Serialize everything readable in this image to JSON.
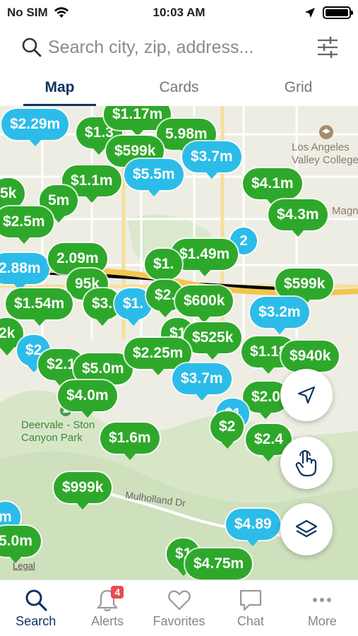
{
  "status_bar": {
    "carrier": "No SIM",
    "time": "10:03 AM"
  },
  "search": {
    "placeholder": "Search city, zip, address..."
  },
  "tabs": [
    {
      "label": "Map",
      "active": true
    },
    {
      "label": "Cards",
      "active": false
    },
    {
      "label": "Grid",
      "active": false
    }
  ],
  "map": {
    "labels": {
      "college": "Los Angeles\nValley College",
      "magn": "Magn",
      "park": "Deervale - Ston\nCanyon Park",
      "road": "Mulholland Dr",
      "legal": "Legal"
    },
    "pins": [
      {
        "price": "$2.29m",
        "color": "blue"
      },
      {
        "price": "$1.3",
        "color": "green"
      },
      {
        "price": "$1.17m",
        "color": "green"
      },
      {
        "price": "5.98m",
        "color": "green"
      },
      {
        "price": "$599k",
        "color": "green"
      },
      {
        "price": "$3.7m",
        "color": "blue"
      },
      {
        "price": "$5.5m",
        "color": "blue"
      },
      {
        "price": "$1.1m",
        "color": "green"
      },
      {
        "price": "5k",
        "color": "green"
      },
      {
        "price": "5m",
        "color": "green"
      },
      {
        "price": "$2.5m",
        "color": "green"
      },
      {
        "price": "$4.1m",
        "color": "green"
      },
      {
        "price": "$4.3m",
        "color": "green"
      },
      {
        "price": "$1.49m",
        "color": "green"
      },
      {
        "price": "2.88m",
        "color": "blue"
      },
      {
        "price": "2.09m",
        "color": "green"
      },
      {
        "price": "95k",
        "color": "green"
      },
      {
        "price": "$1.",
        "color": "green"
      },
      {
        "price": "$599k",
        "color": "green"
      },
      {
        "price": "$1.54m",
        "color": "green"
      },
      {
        "price": "$3.",
        "color": "green"
      },
      {
        "price": "$1.",
        "color": "blue"
      },
      {
        "price": "$2.",
        "color": "green"
      },
      {
        "price": "$600k",
        "color": "green"
      },
      {
        "price": "$3.2m",
        "color": "blue"
      },
      {
        "price": "2k",
        "color": "green"
      },
      {
        "price": "$2",
        "color": "blue"
      },
      {
        "price": "$1",
        "color": "green"
      },
      {
        "price": "$525k",
        "color": "green"
      },
      {
        "price": "$1.18",
        "color": "green"
      },
      {
        "price": "$940k",
        "color": "green"
      },
      {
        "price": "$2.1",
        "color": "green"
      },
      {
        "price": "$5.0m",
        "color": "green"
      },
      {
        "price": "$2.25m",
        "color": "green"
      },
      {
        "price": "$3.7m",
        "color": "blue"
      },
      {
        "price": "$2.0",
        "color": "green"
      },
      {
        "price": "$4.0m",
        "color": "green"
      },
      {
        "price": "$1",
        "color": "blue"
      },
      {
        "price": "$2",
        "color": "green"
      },
      {
        "price": "$2.4",
        "color": "green"
      },
      {
        "price": "$1.6m",
        "color": "green"
      },
      {
        "price": "$999k",
        "color": "green"
      },
      {
        "price": "m",
        "color": "blue"
      },
      {
        "price": "$4.89",
        "color": "blue"
      },
      {
        "price": "5.0m",
        "color": "green"
      },
      {
        "price": "$1",
        "color": "green"
      },
      {
        "price": "$4.75m",
        "color": "green"
      }
    ],
    "cluster_count": "2"
  },
  "nav": [
    {
      "label": "Search",
      "icon": "search-icon",
      "active": true
    },
    {
      "label": "Alerts",
      "icon": "bell-icon",
      "active": false,
      "badge": "4"
    },
    {
      "label": "Favorites",
      "icon": "heart-icon",
      "active": false
    },
    {
      "label": "Chat",
      "icon": "chat-icon",
      "active": false
    },
    {
      "label": "More",
      "icon": "more-dots-icon",
      "active": false
    }
  ],
  "colors": {
    "accent": "#0f3361",
    "pin_green": "#2ea82a",
    "pin_blue": "#2cbce9",
    "badge": "#e94c4c"
  }
}
